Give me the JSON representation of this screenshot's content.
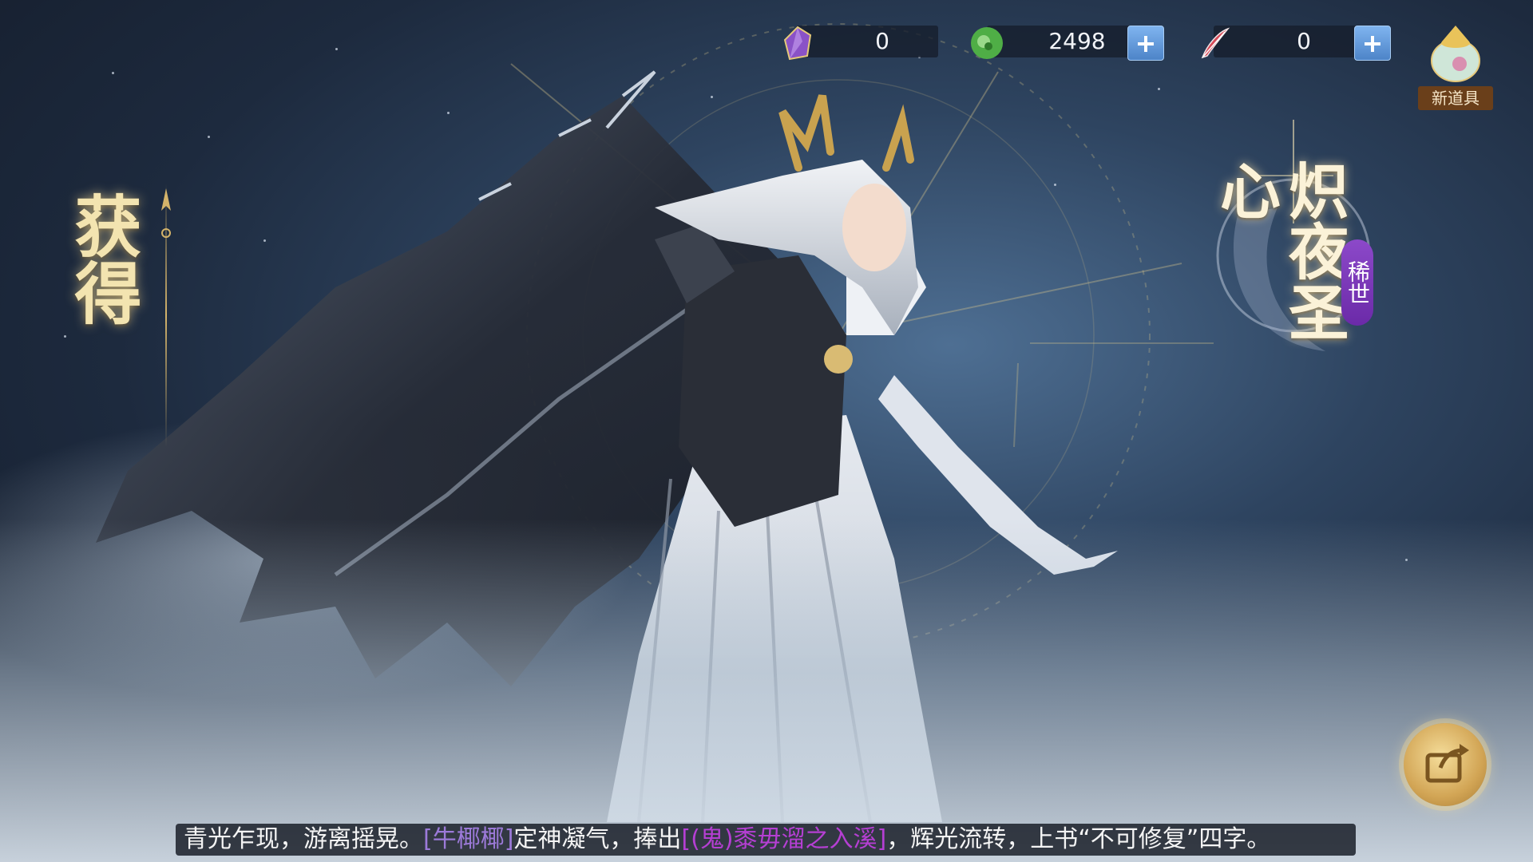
{
  "currency": {
    "crystal": {
      "icon": "purple-crystal-icon",
      "value": "0"
    },
    "jade": {
      "icon": "green-jade-icon",
      "value": "2498"
    },
    "feather": {
      "icon": "red-feather-quill-icon",
      "value": "0"
    }
  },
  "new_item": {
    "icon": "treasure-pouch-icon",
    "label": "新道具"
  },
  "obtained": {
    "title": "获得"
  },
  "costume": {
    "name": "炽夜圣心",
    "rarity": "稀世"
  },
  "share": {
    "icon": "share-icon"
  },
  "subtitle": {
    "part1": "青光乍现，游离摇晃。",
    "user": "[牛椰椰]",
    "part2": "定神凝气，捧出",
    "item": "[(鬼)黍毋溜之入溪]",
    "part3": "，辉光流转，上书“不可修复”四字。"
  },
  "colors": {
    "accent_gold": "#f3e4b0",
    "plus_blue": "#5d93d6",
    "rarity_purple": "#7a36b8",
    "username": "#9c7ad9",
    "item": "#b53fd3"
  }
}
